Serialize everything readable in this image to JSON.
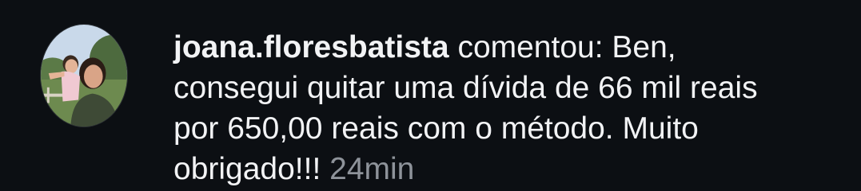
{
  "notification": {
    "username": "joana.floresbatista",
    "comment_lines": [
      " comentou: Ben,",
      "consegui quitar uma dívida de 66 mil reais",
      "por 650,00 reais com o método. Muito",
      "obrigado!!! "
    ],
    "timestamp": "24min",
    "avatar_icon": "user-profile-photo-icon"
  },
  "colors": {
    "background": "#0c0f13",
    "text": "#f2f3f5",
    "timestamp": "#8e939a"
  }
}
